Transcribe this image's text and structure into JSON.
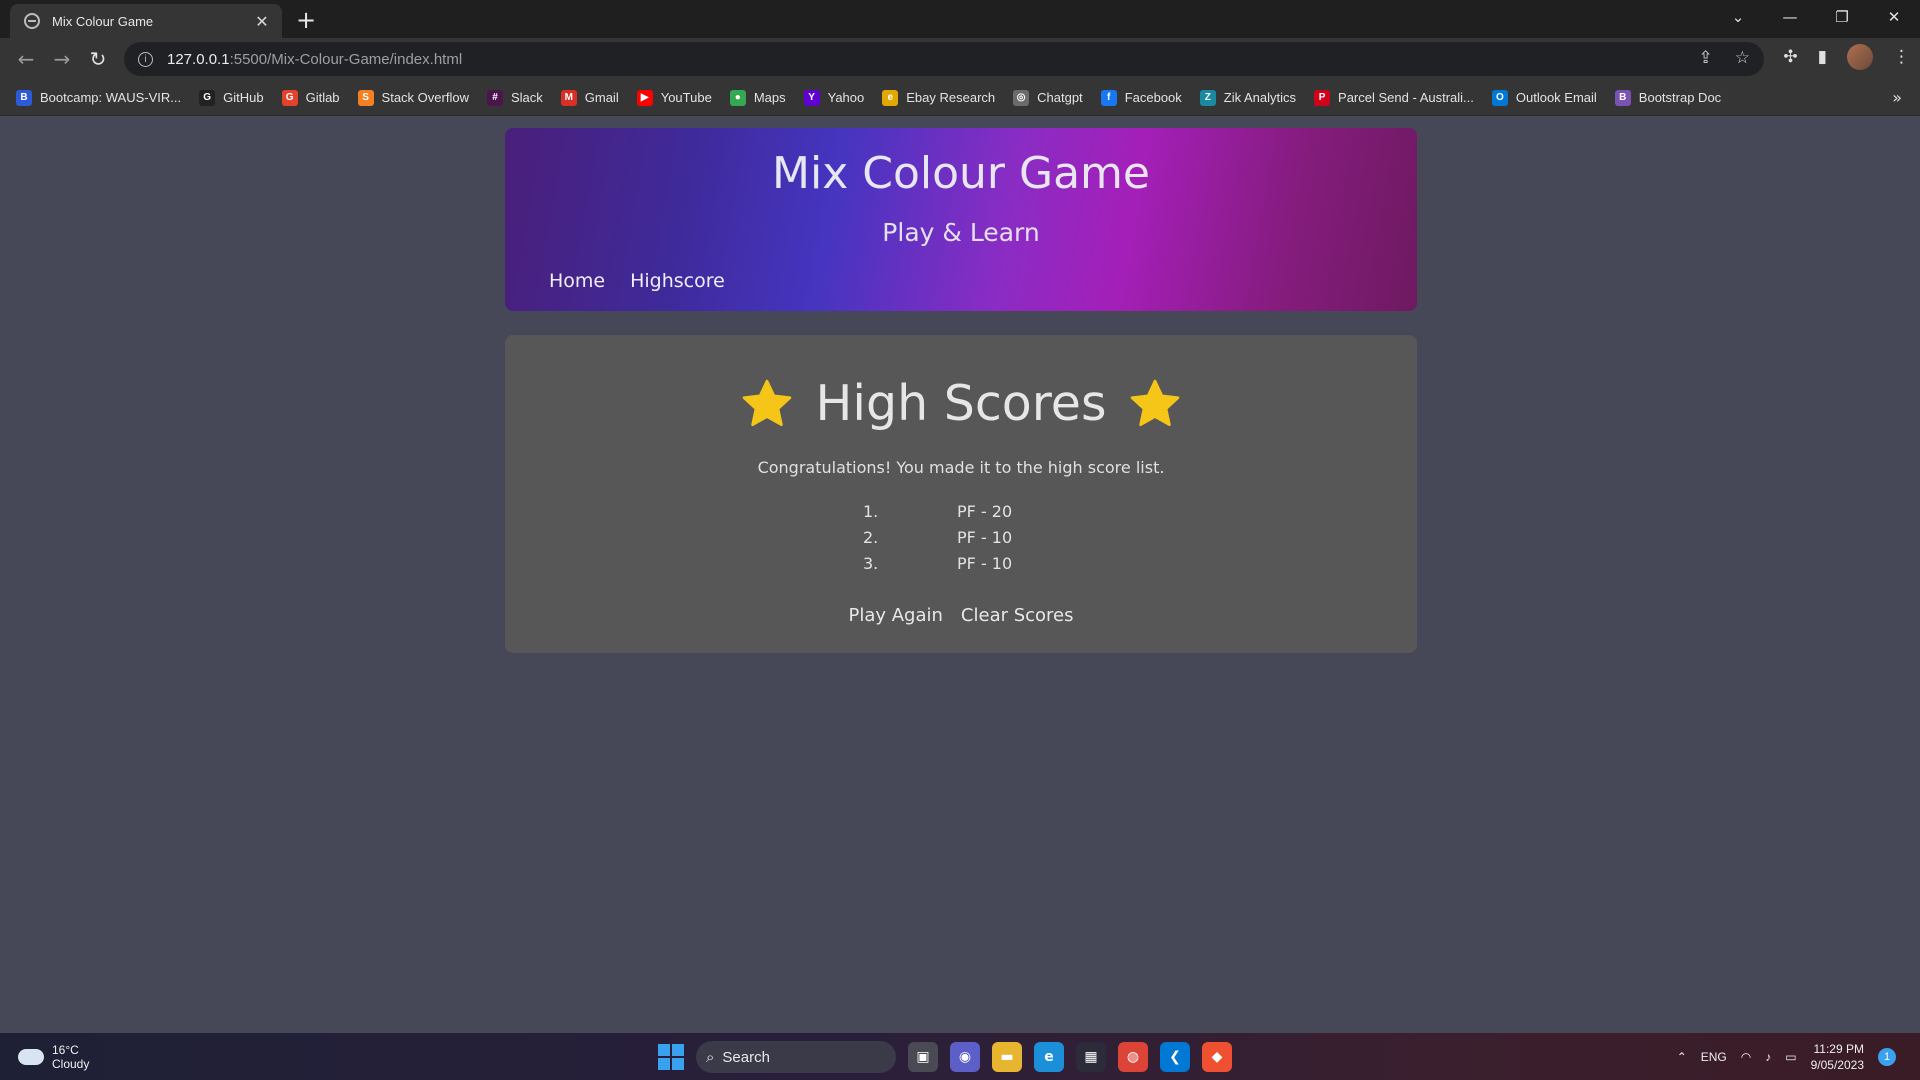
{
  "browser": {
    "tab_title": "Mix Colour Game",
    "new_tab": "+",
    "url_host": "127.0.0.1",
    "url_path": ":5500/Mix-Colour-Game/index.html"
  },
  "bookmarks": [
    {
      "label": "Bootcamp: WAUS-VIR...",
      "icon": "bootcamp-icon",
      "color": "#2d5bd8",
      "glyph": "B"
    },
    {
      "label": "GitHub",
      "icon": "github-icon",
      "color": "#222222",
      "glyph": "G"
    },
    {
      "label": "Gitlab",
      "icon": "gitlab-icon",
      "color": "#e2432a",
      "glyph": "G"
    },
    {
      "label": "Stack Overflow",
      "icon": "stackoverflow-icon",
      "color": "#f48024",
      "glyph": "S"
    },
    {
      "label": "Slack",
      "icon": "slack-icon",
      "color": "#4a154b",
      "glyph": "#"
    },
    {
      "label": "Gmail",
      "icon": "gmail-icon",
      "color": "#d93025",
      "glyph": "M"
    },
    {
      "label": "YouTube",
      "icon": "youtube-icon",
      "color": "#ff0000",
      "glyph": "▶"
    },
    {
      "label": "Maps",
      "icon": "maps-icon",
      "color": "#34a853",
      "glyph": "●"
    },
    {
      "label": "Yahoo",
      "icon": "yahoo-icon",
      "color": "#6001d2",
      "glyph": "Y"
    },
    {
      "label": "Ebay Research",
      "icon": "ebay-icon",
      "color": "#e0a800",
      "glyph": "e"
    },
    {
      "label": "Chatgpt",
      "icon": "chatgpt-icon",
      "color": "#6b6b6b",
      "glyph": "◎"
    },
    {
      "label": "Facebook",
      "icon": "facebook-icon",
      "color": "#1877f2",
      "glyph": "f"
    },
    {
      "label": "Zik Analytics",
      "icon": "zik-icon",
      "color": "#1a8aa0",
      "glyph": "Z"
    },
    {
      "label": "Parcel Send - Australi...",
      "icon": "parcelsend-icon",
      "color": "#d0021b",
      "glyph": "P"
    },
    {
      "label": "Outlook Email",
      "icon": "outlook-icon",
      "color": "#0078d4",
      "glyph": "O"
    },
    {
      "label": "Bootstrap Doc",
      "icon": "bootstrap-icon",
      "color": "#7952b3",
      "glyph": "B"
    }
  ],
  "header": {
    "title": "Mix Colour Game",
    "subtitle": "Play & Learn",
    "nav": [
      "Home",
      "Highscore"
    ]
  },
  "highscores": {
    "title": "High Scores",
    "message": "Congratulations! You made it to the high score list.",
    "entries": [
      {
        "rank": "1.",
        "entry": "PF - 20"
      },
      {
        "rank": "2.",
        "entry": "PF - 10"
      },
      {
        "rank": "3.",
        "entry": "PF - 10"
      }
    ],
    "play_again": "Play Again",
    "clear_scores": "Clear Scores",
    "star_color": "#f5c518"
  },
  "taskbar": {
    "temperature": "16°C",
    "condition": "Cloudy",
    "search_placeholder": "Search",
    "language": "ENG",
    "time": "11:29 PM",
    "date": "9/05/2023",
    "notifications": "1"
  },
  "colors": {
    "page_bg": "#464857",
    "card_bg": "#575757",
    "header_gradient": [
      "#4a1f7a",
      "#4535c0",
      "#a41fb8",
      "#6e1a60"
    ]
  }
}
